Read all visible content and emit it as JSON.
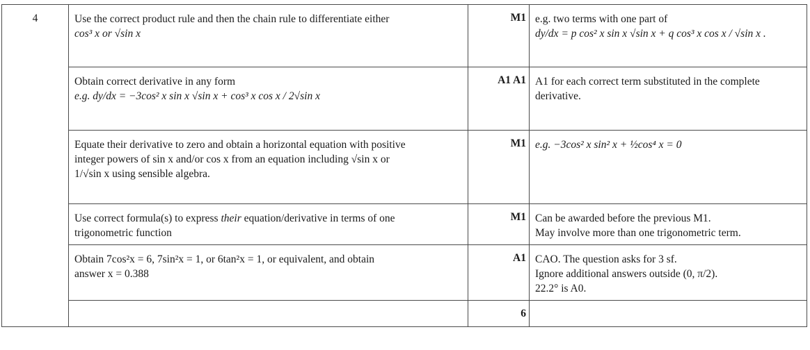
{
  "question_number": "4",
  "rows": [
    {
      "text_line1": "Use the correct product rule and then the chain rule to differentiate either",
      "text_line2": "cos³ x or √sin x",
      "mark": "M1",
      "notes_line1": "e.g. two terms with one part of",
      "notes_line2": "dy/dx = p cos² x sin x √sin x + q cos³ x cos x / √sin x ."
    },
    {
      "text_line1": "Obtain correct derivative in any form",
      "text_line2": "e.g. dy/dx = −3cos² x sin x √sin x + cos³ x cos x / 2√sin x",
      "mark": "A1 A1",
      "notes_line1": "A1 for each correct term substituted in the complete",
      "notes_line2": "derivative."
    },
    {
      "text_line1": "Equate their derivative to zero and obtain a horizontal equation with positive",
      "text_line2": "integer powers of sin x and/or cos x from an equation including √sin x  or",
      "text_line3": "1/√sin x  using sensible algebra.",
      "mark": "M1",
      "notes_line1": "e.g. −3cos² x sin² x + ½cos⁴ x = 0"
    },
    {
      "text_prefix": "Use correct formula(s) to express",
      "text_italic": "their",
      "text_suffix": "equation/derivative in terms of one",
      "text_line2": "trigonometric function",
      "mark": "M1",
      "notes_line1": "Can be awarded before the previous M1.",
      "notes_line2": "May involve more than one trigonometric term."
    },
    {
      "text_line1": "Obtain 7cos²x = 6, 7sin²x = 1, or 6tan²x = 1, or equivalent, and obtain",
      "text_line2": "answer x = 0.388",
      "mark": "A1",
      "notes_line1": "CAO.  The question asks for 3 sf.",
      "notes_line2": "Ignore additional answers outside (0, π/2).",
      "notes_line3": "22.2°  is A0."
    }
  ],
  "total": "6"
}
